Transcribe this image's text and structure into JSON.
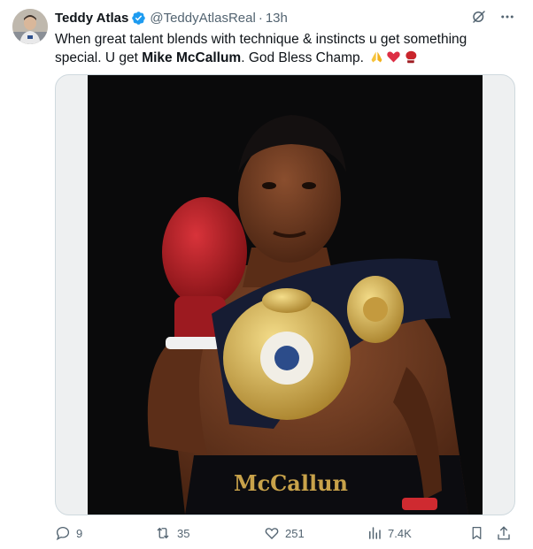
{
  "author": {
    "name": "Teddy Atlas",
    "handle": "@TeddyAtlasReal",
    "separator": "·",
    "time": "13h"
  },
  "tweet": {
    "text_part1": "When great talent blends with technique & instincts u get something special. U get ",
    "text_bold": "Mike McCallum",
    "text_part2": ". God Bless Champ. ",
    "emojis": [
      "folded-hands",
      "red-heart",
      "boxing-glove"
    ]
  },
  "media": {
    "trunks_text": "McCallun"
  },
  "actions": {
    "replies": "9",
    "reposts": "35",
    "likes": "251",
    "views": "7.4K"
  },
  "colors": {
    "text": "#0f1419",
    "secondary": "#536471",
    "verified": "#1d9bf0",
    "border": "#cfd9de"
  },
  "icons": [
    "verified-badge-icon",
    "grok-icon",
    "more-icon",
    "reply-icon",
    "repost-icon",
    "like-icon",
    "views-icon",
    "bookmark-icon",
    "share-icon"
  ]
}
